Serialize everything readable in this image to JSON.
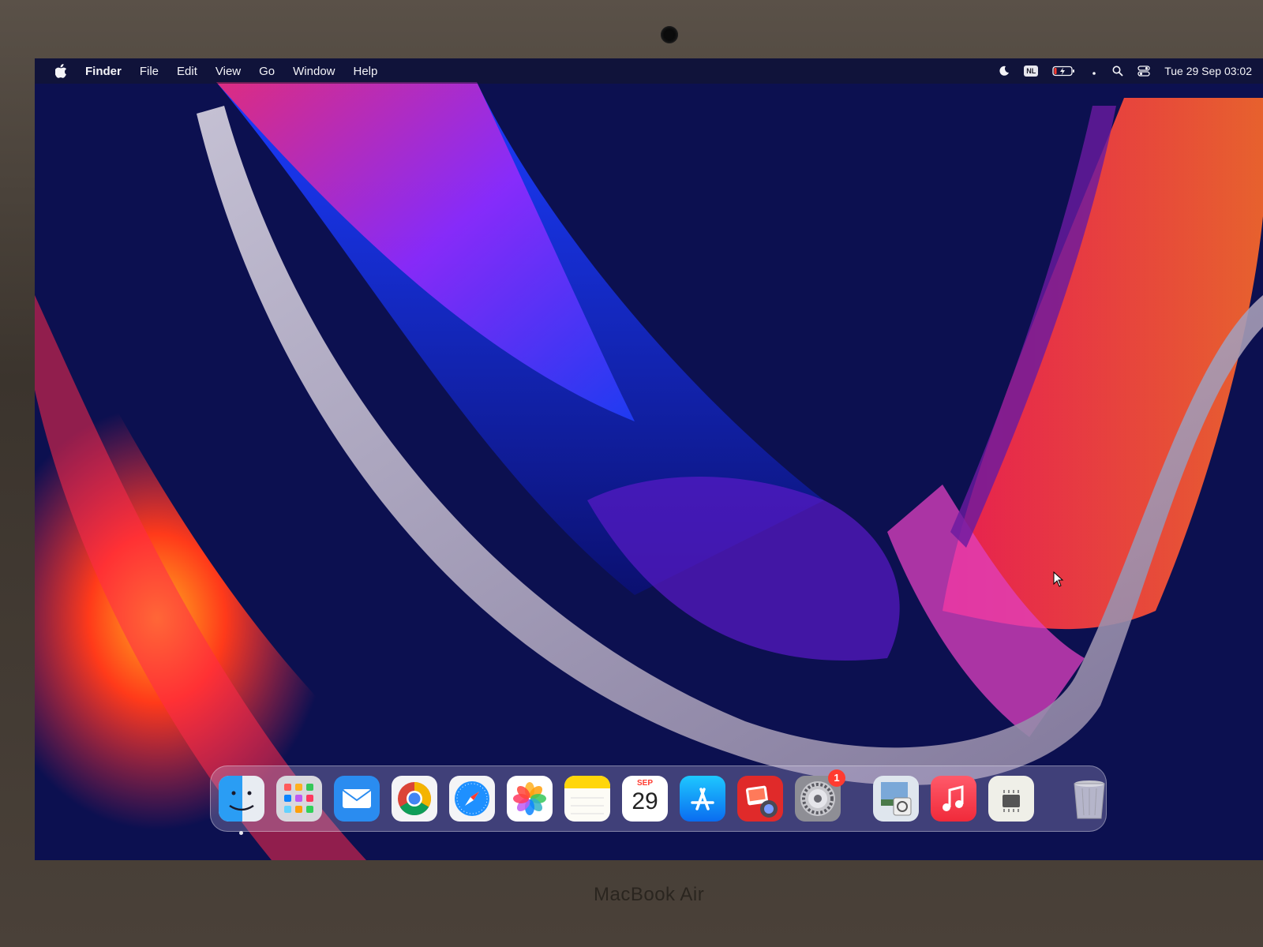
{
  "menubar": {
    "apple_icon": "apple-logo-icon",
    "app_name": "Finder",
    "menus": [
      "File",
      "Edit",
      "View",
      "Go",
      "Window",
      "Help"
    ],
    "status": {
      "focus_icon": "moon-icon",
      "input_source": "NL",
      "battery_icon": "battery-charging-icon",
      "wifi_icon": "wifi-dot-icon",
      "search_icon": "spotlight-search-icon",
      "control_center_icon": "control-center-icon",
      "clock": "Tue 29 Sep  03:02"
    }
  },
  "dock": {
    "apps": [
      {
        "name": "Finder",
        "icon": "finder-icon",
        "running": true
      },
      {
        "name": "Launchpad",
        "icon": "launchpad-icon"
      },
      {
        "name": "Mail",
        "icon": "mail-icon"
      },
      {
        "name": "Chrome",
        "icon": "chrome-icon"
      },
      {
        "name": "Safari",
        "icon": "safari-icon"
      },
      {
        "name": "Photos",
        "icon": "photos-icon"
      },
      {
        "name": "Notes",
        "icon": "notes-icon"
      },
      {
        "name": "Calendar",
        "icon": "calendar-icon",
        "month": "SEP",
        "day": "29"
      },
      {
        "name": "App Store",
        "icon": "app-store-icon"
      },
      {
        "name": "Photo Booth",
        "icon": "photo-booth-icon"
      },
      {
        "name": "System Preferences",
        "icon": "settings-gear-icon",
        "badge": "1"
      },
      {
        "name": "Preview",
        "icon": "preview-icon"
      },
      {
        "name": "Music",
        "icon": "music-icon"
      },
      {
        "name": "System Information",
        "icon": "system-info-icon"
      },
      {
        "name": "Trash",
        "icon": "trash-icon"
      }
    ]
  },
  "device_label": "MacBook Air"
}
